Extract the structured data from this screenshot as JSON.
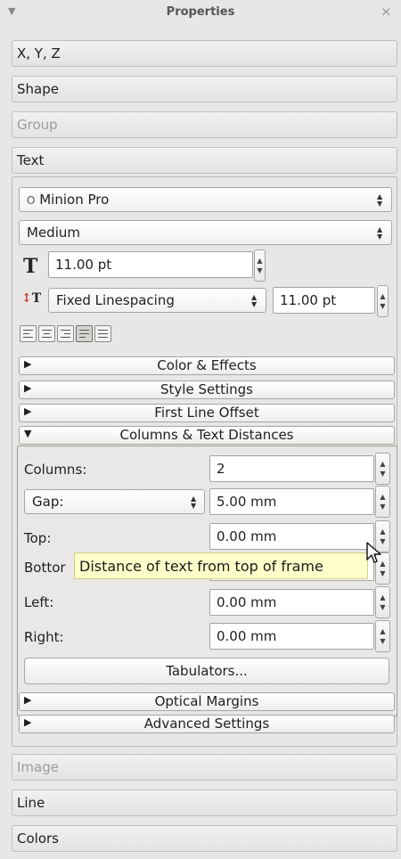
{
  "window": {
    "title": "Properties",
    "collapse_icon": "triangle-down-icon",
    "close_icon": "close-icon"
  },
  "sections": {
    "xyz": "X, Y, Z",
    "shape": "Shape",
    "group": "Group",
    "text": "Text",
    "image": "Image",
    "line": "Line",
    "colors": "Colors"
  },
  "text_panel": {
    "font_family": "Minion Pro",
    "font_icon": "Ο",
    "font_style": "Medium",
    "font_size": "11.00 pt",
    "linespacing_mode": "Fixed Linespacing",
    "linespacing_value": "11.00 pt",
    "alignment_buttons": [
      "align-left",
      "align-center",
      "align-right",
      "align-justify",
      "align-forced-justify"
    ],
    "active_alignment": 3
  },
  "collapsibles": {
    "color_effects": "Color & Effects",
    "style_settings": "Style Settings",
    "first_line_offset": "First Line Offset",
    "columns_text_distances": "Columns & Text Distances",
    "optical_margins": "Optical Margins",
    "advanced_settings": "Advanced Settings"
  },
  "columns": {
    "columns_label": "Columns:",
    "columns_value": "2",
    "gap_mode": "Gap:",
    "gap_value": "5.00 mm",
    "top_label": "Top:",
    "top_value": "0.00 mm",
    "bottom_label": "Bottor",
    "bottom_value": "",
    "left_label": "Left:",
    "left_value": "0.00 mm",
    "right_label": "Right:",
    "right_value": "0.00 mm",
    "tabulators_button": "Tabulators..."
  },
  "tooltip": "Distance of text from top of frame"
}
